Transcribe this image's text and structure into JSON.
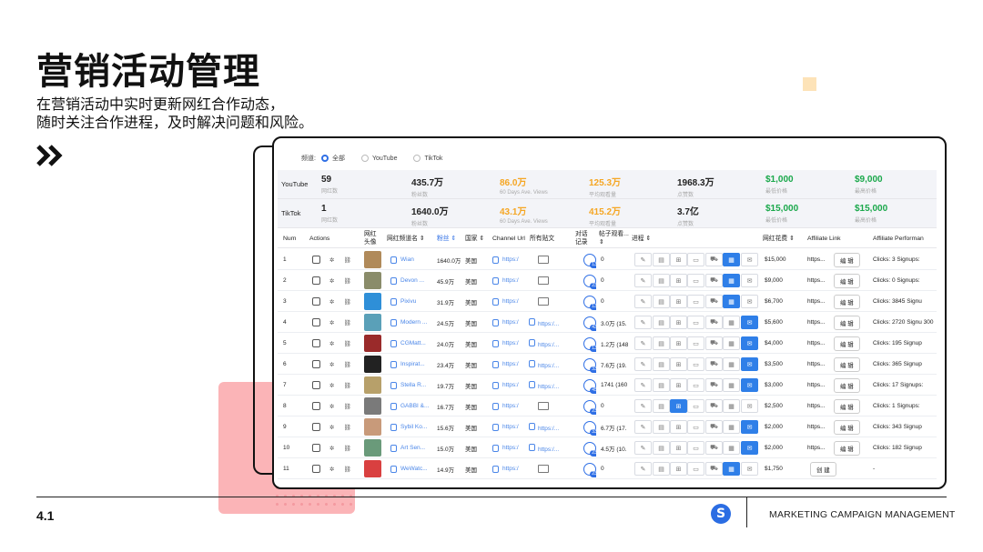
{
  "slide": {
    "title": "营销活动管理",
    "subtitle_line1": "在营销活动中实时更新网红合作动态，",
    "subtitle_line2": "随时关注合作进程，及时解决问题和风险。",
    "page_number": "4.1",
    "footer_text": "MARKETING CAMPAIGN MANAGEMENT",
    "logo_letter": "S",
    "accent": "#2f6fe5",
    "deco_pink": "#fbb4b7",
    "deco_peach": "#fde3b8"
  },
  "filter": {
    "label": "频道:",
    "options": [
      "全部",
      "YouTube",
      "TikTok"
    ],
    "selected": "全部"
  },
  "stats": [
    {
      "platform": "YouTube",
      "items": [
        {
          "value": "59",
          "label": "网红数"
        },
        {
          "value": "435.7万",
          "label": "粉丝数"
        },
        {
          "value": "86.0万",
          "label": "60 Days Ave. Views",
          "color": "orange"
        },
        {
          "value": "125.3万",
          "label": "平均观看量",
          "color": "orange"
        },
        {
          "value": "1968.3万",
          "label": "点赞数"
        },
        {
          "value": "$1,000",
          "label": "最低价格",
          "color": "green"
        },
        {
          "value": "$9,000",
          "label": "最高价格",
          "color": "green"
        }
      ]
    },
    {
      "platform": "TikTok",
      "items": [
        {
          "value": "1",
          "label": "网红数"
        },
        {
          "value": "1640.0万",
          "label": "粉丝数"
        },
        {
          "value": "43.1万",
          "label": "60 Days Ave. Views",
          "color": "orange"
        },
        {
          "value": "415.2万",
          "label": "平均观看量",
          "color": "orange"
        },
        {
          "value": "3.7亿",
          "label": "点赞数"
        },
        {
          "value": "$15,000",
          "label": "最低价格",
          "color": "green"
        },
        {
          "value": "$15,000",
          "label": "最高价格",
          "color": "green"
        }
      ]
    }
  ],
  "columns": {
    "num": "Num",
    "actions": "Actions",
    "avatar": "网红头像",
    "channel_name": "网红频道名 ⇕",
    "fans": "粉丝 ⇕",
    "country": "国家 ⇕",
    "channel_url": "Channel Url",
    "all_posts": "所有贴文",
    "chat": "对话记录",
    "post_views": "帖子观看... ⇕",
    "progress": "进程 ⇕",
    "fee": "网红花费 ⇕",
    "affiliate_link": "Affiliate Link",
    "affiliate_perf": "Affiliate Performan"
  },
  "rows": [
    {
      "num": "1",
      "name": "Wian",
      "fans": "1640.0万",
      "country": "美国",
      "url": "https:/",
      "posts_url": "",
      "chat_badge": "13",
      "views": "0",
      "progress_step": 5,
      "fee": "$15,000",
      "link": "https...",
      "action": "编 辑",
      "perf": "Clicks: 3 Signups:",
      "avatar_color": "#b08a5a"
    },
    {
      "num": "2",
      "name": "Devon ...",
      "fans": "45.9万",
      "country": "美国",
      "url": "https:/",
      "posts_url": "",
      "chat_badge": "23",
      "views": "0",
      "progress_step": 5,
      "fee": "$9,000",
      "link": "https...",
      "action": "编 辑",
      "perf": "Clicks: 0 Signups:",
      "avatar_color": "#8a8c6a"
    },
    {
      "num": "3",
      "name": "Pixivu",
      "fans": "31.9万",
      "country": "美国",
      "url": "https:/",
      "posts_url": "",
      "chat_badge": "13",
      "views": "0",
      "progress_step": 5,
      "fee": "$6,700",
      "link": "https...",
      "action": "编 辑",
      "perf": "Clicks: 3845 Signu",
      "avatar_color": "#2e8fd8"
    },
    {
      "num": "4",
      "name": "Modern ...",
      "fans": "24.5万",
      "country": "美国",
      "url": "https:/",
      "posts_url": "https:/...",
      "chat_badge": "43",
      "views": "3.0万 (15.",
      "progress_step": 6,
      "fee": "$5,600",
      "link": "https...",
      "action": "编 辑",
      "perf": "Clicks: 2720 Signu 300",
      "avatar_color": "#5aa0b8"
    },
    {
      "num": "5",
      "name": "CGMatt...",
      "fans": "24.0万",
      "country": "美国",
      "url": "https:/",
      "posts_url": "https:/...",
      "chat_badge": "13",
      "views": "1.2万 (148",
      "progress_step": 6,
      "fee": "$4,000",
      "link": "https...",
      "action": "编 辑",
      "perf": "Clicks: 195 Signup",
      "avatar_color": "#9a2a2a"
    },
    {
      "num": "6",
      "name": "Inspirat...",
      "fans": "23.4万",
      "country": "美国",
      "url": "https:/",
      "posts_url": "https:/...",
      "chat_badge": "33",
      "views": "7.6万 (19.",
      "progress_step": 6,
      "fee": "$3,500",
      "link": "https...",
      "action": "编 辑",
      "perf": "Clicks: 365 Signup",
      "avatar_color": "#222222"
    },
    {
      "num": "7",
      "name": "Stella R...",
      "fans": "19.7万",
      "country": "美国",
      "url": "https:/",
      "posts_url": "https:/...",
      "chat_badge": "45",
      "views": "1741 (160",
      "progress_step": 6,
      "fee": "$3,000",
      "link": "https...",
      "action": "编 辑",
      "perf": "Clicks: 17 Signups:",
      "avatar_color": "#b7a06a"
    },
    {
      "num": "8",
      "name": "GABBI &...",
      "fans": "16.7万",
      "country": "美国",
      "url": "https:/",
      "posts_url": "",
      "chat_badge": "23",
      "views": "0",
      "progress_step": 2,
      "fee": "$2,500",
      "link": "https...",
      "action": "编 辑",
      "perf": "Clicks: 1 Signups:",
      "avatar_color": "#7a7a7a"
    },
    {
      "num": "9",
      "name": "Sybil Ko...",
      "fans": "15.6万",
      "country": "美国",
      "url": "https:/",
      "posts_url": "https:/...",
      "chat_badge": "33",
      "views": "6.7万 (17.",
      "progress_step": 6,
      "fee": "$2,000",
      "link": "https...",
      "action": "编 辑",
      "perf": "Clicks: 343 Signup",
      "avatar_color": "#c89a7a"
    },
    {
      "num": "10",
      "name": "Art Sen...",
      "fans": "15.0万",
      "country": "美国",
      "url": "https:/",
      "posts_url": "https:/...",
      "chat_badge": "23",
      "views": "4.5万 (10.",
      "progress_step": 6,
      "fee": "$2,000",
      "link": "https...",
      "action": "编 辑",
      "perf": "Clicks: 182 Signup",
      "avatar_color": "#6a9a7a"
    },
    {
      "num": "11",
      "name": "WeWatc...",
      "fans": "14.9万",
      "country": "美国",
      "url": "https:/",
      "posts_url": "",
      "chat_badge": "23",
      "views": "0",
      "progress_step": 5,
      "fee": "$1,750",
      "link": "",
      "action": "创 建",
      "perf": "-",
      "avatar_color": "#d94040"
    }
  ]
}
